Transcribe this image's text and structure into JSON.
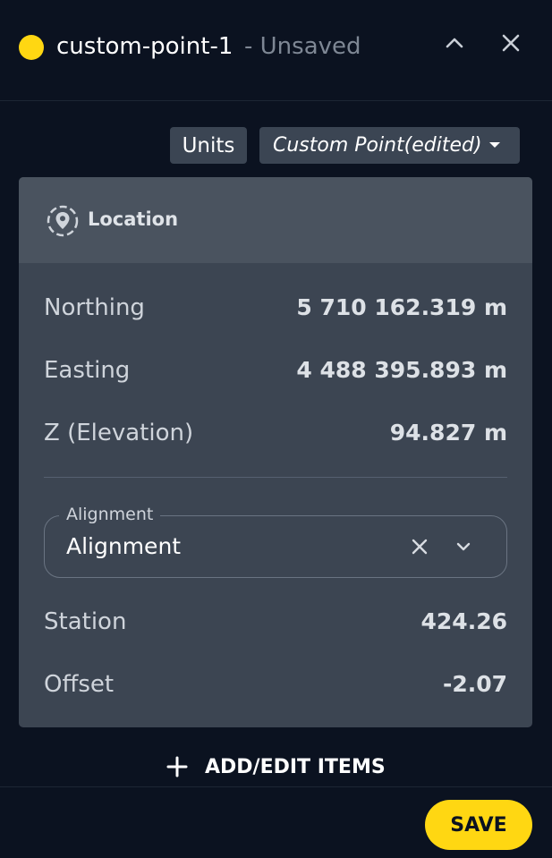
{
  "header": {
    "title": "custom-point-1",
    "status": "- Unsaved",
    "point_color": "#ffd712",
    "collapse_icon": "chevron-up-icon",
    "close_icon": "close-icon"
  },
  "toolbar": {
    "units_label": "Units",
    "preset_label": "Custom Point(edited)"
  },
  "location": {
    "heading": "Location",
    "icon": "location-pin-icon",
    "rows": [
      {
        "label": "Northing",
        "value": "5 710 162.319 m"
      },
      {
        "label": "Easting",
        "value": "4 488 395.893 m"
      },
      {
        "label": "Z (Elevation)",
        "value": "94.827 m"
      }
    ],
    "alignment": {
      "legend": "Alignment",
      "value": "Alignment"
    },
    "station": {
      "label": "Station",
      "value": "424.26"
    },
    "offset": {
      "label": "Offset",
      "value": "-2.07"
    }
  },
  "actions": {
    "add_edit_label": "ADD/EDIT ITEMS",
    "save_label": "SAVE"
  },
  "colors": {
    "background": "#0b1220",
    "accent": "#ffd712",
    "card": "#3c4552"
  }
}
